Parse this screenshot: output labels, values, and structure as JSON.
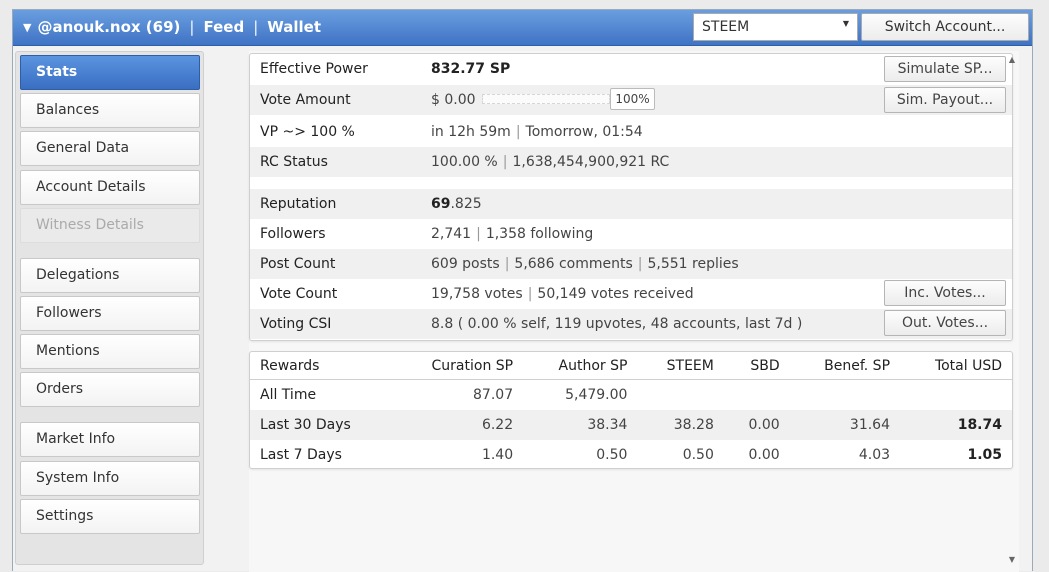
{
  "header": {
    "username": "@anouk.nox (69)",
    "sep": "|",
    "feed": "Feed",
    "wallet": "Wallet",
    "currency": "STEEM",
    "switch_account": "Switch Account..."
  },
  "sidebar": {
    "items": [
      {
        "label": "Stats"
      },
      {
        "label": "Balances"
      },
      {
        "label": "General Data"
      },
      {
        "label": "Account Details"
      },
      {
        "label": "Witness Details"
      },
      {
        "label": "Delegations"
      },
      {
        "label": "Followers"
      },
      {
        "label": "Mentions"
      },
      {
        "label": "Orders"
      },
      {
        "label": "Market Info"
      },
      {
        "label": "System Info"
      },
      {
        "label": "Settings"
      }
    ]
  },
  "stats": {
    "effective_power": {
      "label": "Effective Power",
      "value": "832.77 SP",
      "button": "Simulate SP..."
    },
    "vote_amount": {
      "label": "Vote Amount",
      "value": "$ 0.00",
      "percent": "100%",
      "button": "Sim. Payout..."
    },
    "vp": {
      "label": "VP ~> 100 %",
      "value_a": "in 12h 59m",
      "value_b": "Tomorrow, 01:54"
    },
    "rc": {
      "label": "RC Status",
      "value_a": "100.00 %",
      "value_b": "1,638,454,900,921 RC"
    },
    "reputation": {
      "label": "Reputation",
      "value_int": "69",
      "value_dec": ".825"
    },
    "followers": {
      "label": "Followers",
      "value_a": "2,741",
      "value_b": "1,358 following"
    },
    "post_count": {
      "label": "Post Count",
      "value_a": "609 posts",
      "value_b": "5,686 comments",
      "value_c": "5,551 replies"
    },
    "vote_count": {
      "label": "Vote Count",
      "value_a": "19,758 votes",
      "value_b": "50,149 votes received",
      "button": "Inc. Votes..."
    },
    "voting_csi": {
      "label": "Voting CSI",
      "value": "8.8 ( 0.00 % self, 119 upvotes, 48 accounts, last 7d )",
      "button": "Out. Votes..."
    }
  },
  "rewards": {
    "headers": [
      "Rewards",
      "Curation SP",
      "Author SP",
      "STEEM",
      "SBD",
      "Benef. SP",
      "Total USD"
    ],
    "rows": [
      [
        "All Time",
        "87.07",
        "5,479.00",
        "",
        "",
        "",
        ""
      ],
      [
        "Last 30 Days",
        "6.22",
        "38.34",
        "38.28",
        "0.00",
        "31.64",
        "18.74"
      ],
      [
        "Last 7 Days",
        "1.40",
        "0.50",
        "0.50",
        "0.00",
        "4.03",
        "1.05"
      ]
    ]
  },
  "scrollbar": {
    "up": "▲",
    "down": "▼"
  }
}
